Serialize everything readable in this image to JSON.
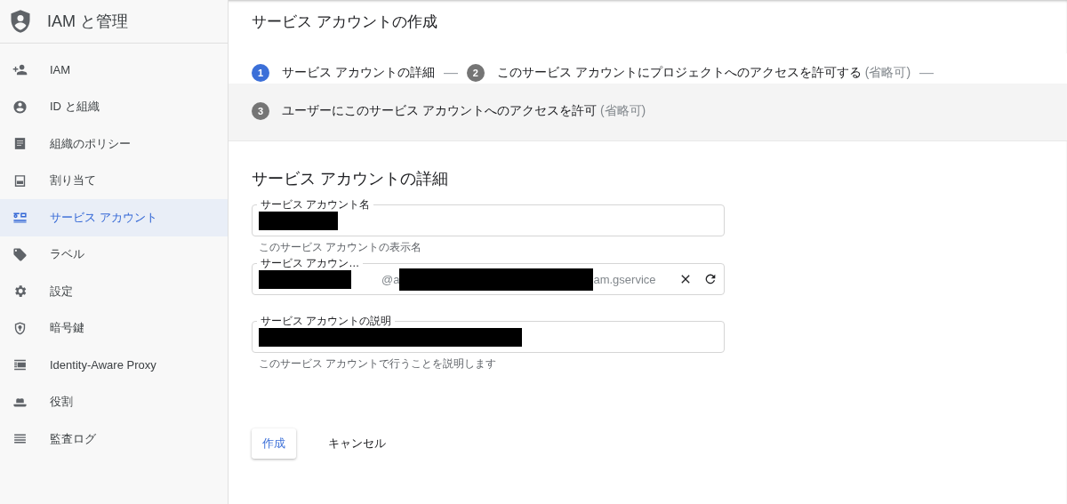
{
  "app": {
    "title": "IAM と管理"
  },
  "sidebar": {
    "items": [
      {
        "label": "IAM",
        "selected": false
      },
      {
        "label": "ID と組織",
        "selected": false
      },
      {
        "label": "組織のポリシー",
        "selected": false
      },
      {
        "label": "割り当て",
        "selected": false
      },
      {
        "label": "サービス アカウント",
        "selected": true
      },
      {
        "label": "ラベル",
        "selected": false
      },
      {
        "label": "設定",
        "selected": false
      },
      {
        "label": "暗号鍵",
        "selected": false
      },
      {
        "label": "Identity-Aware Proxy",
        "selected": false
      },
      {
        "label": "役割",
        "selected": false
      },
      {
        "label": "監査ログ",
        "selected": false
      }
    ]
  },
  "page": {
    "title": "サービス アカウントの作成"
  },
  "stepper": {
    "steps": [
      {
        "number": "1",
        "label": "サービス アカウントの詳細",
        "separator": "—",
        "selected": true
      },
      {
        "number": "2",
        "label": "このサービス アカウントにプロジェクトへのアクセスを許可する",
        "optional": "(省略可)",
        "separator": "—",
        "selected": false
      },
      {
        "number": "3",
        "label": "ユーザーにこのサービス アカウントへのアクセスを許可",
        "optional": "(省略可)",
        "selected": false
      }
    ]
  },
  "form": {
    "heading": "サービス アカウントの詳細",
    "fields": [
      {
        "kind": "text",
        "label": "サービス アカウント名",
        "helper": "このサービス アカウントの表示名"
      },
      {
        "kind": "id",
        "label": "サービス アカウン…",
        "suffix_start": "@a",
        "suffix_end": "am.gservice"
      },
      {
        "kind": "text",
        "label": "サービス アカウントの説明",
        "helper": "このサービス アカウントで行うことを説明します"
      }
    ]
  },
  "buttons": [
    {
      "kind": "primary",
      "label": "作成"
    },
    {
      "kind": "text",
      "label": "キャンセル"
    }
  ]
}
